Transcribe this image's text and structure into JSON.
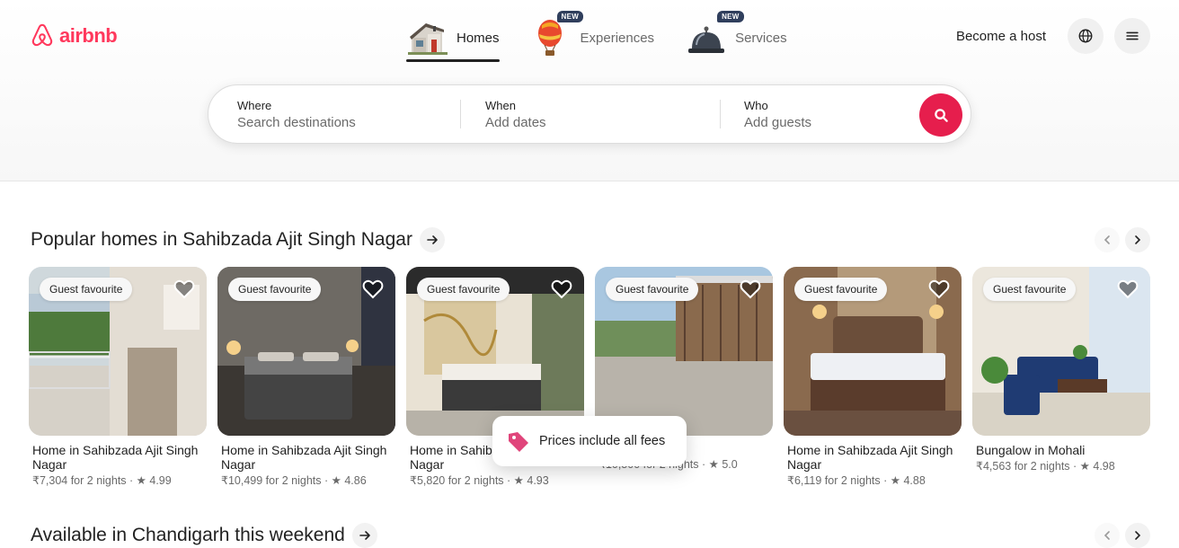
{
  "brand": {
    "name": "airbnb",
    "color": "#ff385c",
    "icon": "airbnb-logo-icon"
  },
  "categories": [
    {
      "label": "Homes",
      "icon": "house-icon",
      "active": true,
      "badge": ""
    },
    {
      "label": "Experiences",
      "icon": "hot-air-balloon-icon",
      "active": false,
      "badge": "NEW"
    },
    {
      "label": "Services",
      "icon": "service-bell-icon",
      "active": false,
      "badge": "NEW"
    }
  ],
  "header": {
    "host_label": "Become a host",
    "language_icon": "globe-icon",
    "menu_icon": "hamburger-menu-icon"
  },
  "search": {
    "where": {
      "label": "Where",
      "placeholder": "Search destinations"
    },
    "when": {
      "label": "When",
      "placeholder": "Add dates"
    },
    "who": {
      "label": "Who",
      "placeholder": "Add guests"
    },
    "button_icon": "search-icon",
    "button_color": "#e61e4d"
  },
  "sections": [
    {
      "title": "Popular homes in Sahibzada Ajit Singh Nagar"
    },
    {
      "title": "Available in Chandigarh this weekend"
    }
  ],
  "listings": [
    {
      "badge": "Guest favourite",
      "title": "Home in Sahibzada Ajit Singh Nagar",
      "price": "₹7,304 for 2 nights",
      "rating": "4.99"
    },
    {
      "badge": "Guest favourite",
      "title": "Home in Sahibzada Ajit Singh Nagar",
      "price": "₹10,499 for 2 nights",
      "rating": "4.86"
    },
    {
      "badge": "Guest favourite",
      "title": "Home in Sahibzada Ajit Singh Nagar",
      "price": "₹5,820 for 2 nights",
      "rating": "4.93"
    },
    {
      "badge": "Guest favourite",
      "title": "",
      "price": "₹10,500 for 2 nights",
      "rating": "5.0"
    },
    {
      "badge": "Guest favourite",
      "title": "Home in Sahibzada Ajit Singh Nagar",
      "price": "₹6,119 for 2 nights",
      "rating": "4.88"
    },
    {
      "badge": "Guest favourite",
      "title": "Bungalow in Mohali",
      "price": "₹4,563 for 2 nights",
      "rating": "4.98"
    }
  ],
  "toast": {
    "text": "Prices include all fees",
    "icon": "price-tag-icon"
  }
}
